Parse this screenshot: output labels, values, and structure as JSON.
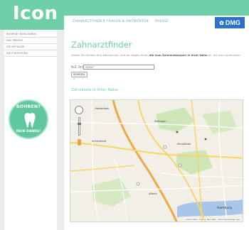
{
  "header": {
    "logo": "Icon",
    "nav": [
      "ZAHNARZTFINDER",
      "FRAGEN & ANTWORTEN",
      "PRESSE"
    ],
    "brand": "DMG",
    "colors": {
      "accent": "#6fcfa8",
      "brand": "#2a73c9"
    }
  },
  "sidebar": {
    "items": [
      {
        "label": "BOHREN? NEIN DANKE!"
      },
      {
        "label": "DAS PRINZIP"
      },
      {
        "label": "DIE METHODE"
      },
      {
        "label": "DIE FORSCHUNG"
      }
    ],
    "badge": {
      "top": "BOHREN?",
      "bottom": "NEIN DANKE!",
      "icon": "tooth-icon"
    }
  },
  "main": {
    "title": "Zahnarztfinder",
    "description_pre": "Geben Sie einfach Ihre Adresse ein, und wir zeigen Ihnen ",
    "description_bold": "die Icon Zahnarztpraxen in Ihrer Nähe",
    "description_post": " an, die Icon verwenden.",
    "plz_label": "PLZ, Ort:",
    "plz_value": "22527",
    "submit_label": "SENDEN",
    "subtitle": "Zahnärzte in Ihrer Nähe"
  },
  "map": {
    "labels": [
      "Halstenbek",
      "Schenefeld",
      "Rellingen",
      "Hamburg",
      "Eimsbüttel",
      "Altona"
    ],
    "city": "Hamburg",
    "copyright": "Kartendaten ©2011 Tele Atlas · Nutzungsbedingungen"
  }
}
